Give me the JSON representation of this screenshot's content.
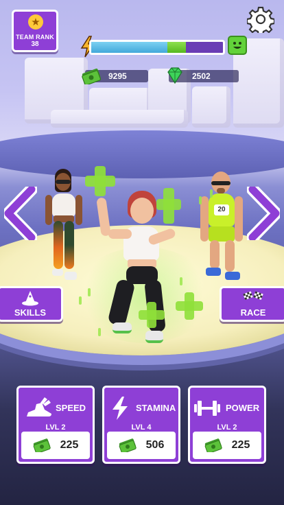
{
  "team_rank": {
    "label": "TEAM RANK",
    "value": "38",
    "icon": "star-icon"
  },
  "settings": {
    "icon": "gear-icon"
  },
  "progress": {
    "current": 0.58,
    "next_segment": 0.14,
    "left_icon": "lightning-icon",
    "right_icon": "smiley-face-icon"
  },
  "currency": {
    "cash": "9295",
    "gems": "2502",
    "cash_icon": "cash-icon",
    "gem_icon": "gem-icon"
  },
  "nav": {
    "prev_icon": "chevron-left-icon",
    "next_icon": "chevron-right-icon"
  },
  "skills_button": {
    "label": "SKILLS",
    "icon": "wizard-hat-icon"
  },
  "race_button": {
    "label": "RACE",
    "icon": "checkered-flags-icon"
  },
  "upgrades": [
    {
      "name": "SPEED",
      "level": "LVL 2",
      "cost": "225",
      "icon": "winged-shoe-icon"
    },
    {
      "name": "STAMINA",
      "level": "LVL 4",
      "cost": "506",
      "icon": "lightning-icon"
    },
    {
      "name": "POWER",
      "level": "LVL 2",
      "cost": "225",
      "icon": "dumbbell-icon"
    }
  ],
  "runner_number": "20",
  "colors": {
    "panel": "#8e3fd6",
    "accent_green": "#8fe03a",
    "progress_blue": "#42a8da"
  }
}
